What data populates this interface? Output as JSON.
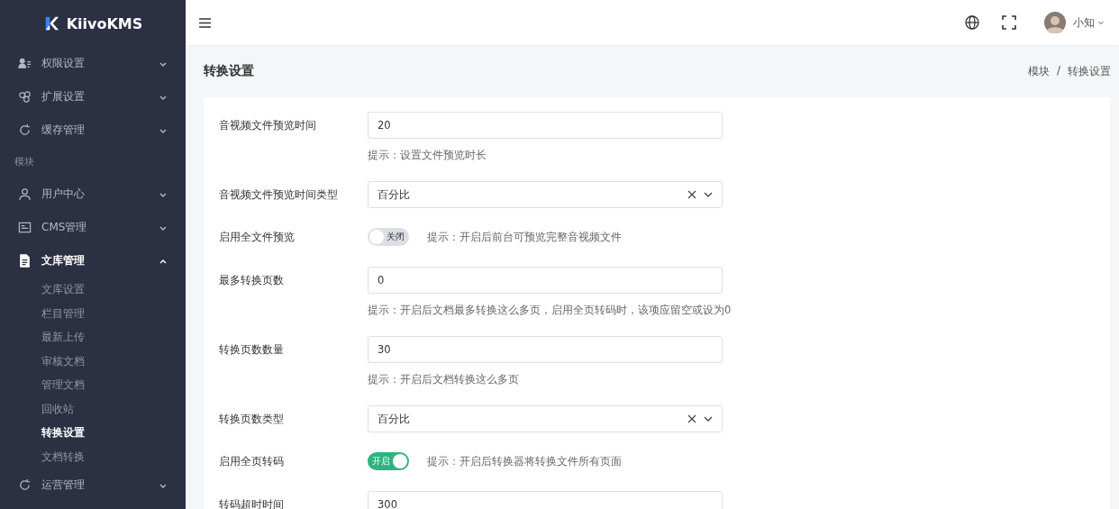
{
  "brand": {
    "name": "KiivoKMS"
  },
  "sidebar": {
    "items": [
      {
        "kind": "group",
        "label": "权限设置",
        "expanded": false
      },
      {
        "kind": "group",
        "label": "扩展设置",
        "expanded": false
      },
      {
        "kind": "group",
        "label": "缓存管理",
        "expanded": false
      },
      {
        "kind": "section",
        "label": "模块"
      },
      {
        "kind": "group",
        "label": "用户中心",
        "expanded": false
      },
      {
        "kind": "group",
        "label": "CMS管理",
        "expanded": false
      },
      {
        "kind": "group",
        "label": "文库管理",
        "expanded": true,
        "children": [
          {
            "label": "文库设置",
            "selected": false
          },
          {
            "label": "栏目管理",
            "selected": false
          },
          {
            "label": "最新上传",
            "selected": false
          },
          {
            "label": "审核文档",
            "selected": false
          },
          {
            "label": "管理文档",
            "selected": false
          },
          {
            "label": "回收站",
            "selected": false
          },
          {
            "label": "转换设置",
            "selected": true
          },
          {
            "label": "文档转换",
            "selected": false
          }
        ]
      },
      {
        "kind": "group",
        "label": "运营管理",
        "expanded": false
      }
    ]
  },
  "header": {
    "user": "小知"
  },
  "page": {
    "title": "转换设置",
    "breadcrumb": [
      "模块",
      "转换设置"
    ],
    "breadcrumb_separator": "/"
  },
  "form": {
    "fields": [
      {
        "kind": "input",
        "label": "音视频文件预览时间",
        "value": "20",
        "hint": "提示：设置文件预览时长"
      },
      {
        "kind": "select",
        "label": "音视频文件预览时间类型",
        "value": "百分比"
      },
      {
        "kind": "switch",
        "label": "启用全文件预览",
        "on": false,
        "state_text": "关闭",
        "hint": "提示：开启后前台可预览完整音视频文件"
      },
      {
        "kind": "input",
        "label": "最多转换页数",
        "value": "0",
        "hint": "提示：开启后文档最多转换这么多页，启用全页转码时，该项应留空或设为0"
      },
      {
        "kind": "input",
        "label": "转换页数数量",
        "value": "30",
        "hint": "提示：开启后文档转换这么多页"
      },
      {
        "kind": "select",
        "label": "转换页数类型",
        "value": "百分比"
      },
      {
        "kind": "switch",
        "label": "启用全页转码",
        "on": true,
        "state_text": "开启",
        "hint": "提示：开启后转换器将转换文件所有页面"
      },
      {
        "kind": "input",
        "label": "转码超时时间",
        "value": "300"
      }
    ]
  }
}
